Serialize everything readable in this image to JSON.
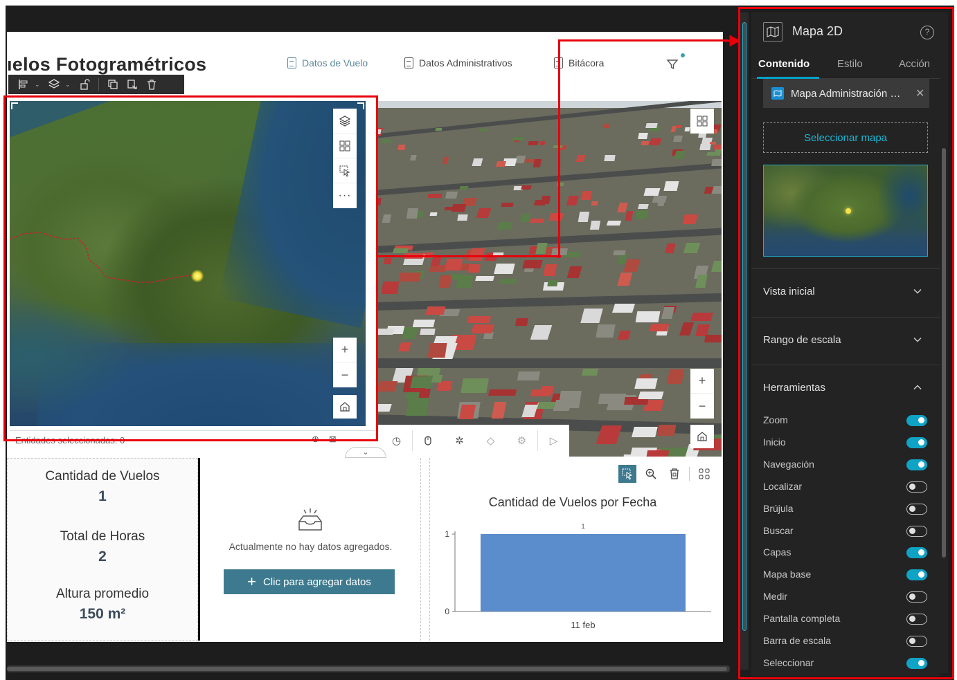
{
  "page": {
    "title": "ıelos Fotogramétricos"
  },
  "nav": {
    "items": [
      {
        "label": "Datos de Vuelo",
        "active": true
      },
      {
        "label": "Datos Administrativos",
        "active": false
      },
      {
        "label": "Bitácora",
        "active": false
      }
    ]
  },
  "widget_toolbar": {
    "icons": [
      "align-icon",
      "layers-icon",
      "unlock-icon",
      "duplicate-icon",
      "copy-to-icon",
      "delete-icon"
    ]
  },
  "map2d": {
    "tools": [
      "layers-icon",
      "basemap-gallery-icon",
      "select-icon",
      "more-icon"
    ],
    "zoom_in": "+",
    "zoom_out": "−",
    "selection_text": "Entidades seleccionadas: 0"
  },
  "scene3d": {
    "zoom_in": "+",
    "zoom_out": "−",
    "bottom_tools": [
      "timer-icon",
      "pan-icon",
      "select-pointer-icon",
      "eraser-icon",
      "settings-icon",
      "play-icon"
    ]
  },
  "stats": {
    "items": [
      {
        "label": "Cantidad de Vuelos",
        "value": "1"
      },
      {
        "label": "Total de Horas",
        "value": "2"
      },
      {
        "label": "Altura promedio",
        "value": "150 m²"
      }
    ]
  },
  "empty_widget": {
    "message": "Actualmente no hay datos agregados.",
    "button_label": "Clic para agregar datos"
  },
  "chart_data": {
    "type": "bar",
    "title": "Cantidad de Vuelos por Fecha",
    "categories": [
      "11 feb"
    ],
    "values": [
      1
    ],
    "data_labels": [
      "1"
    ],
    "ylim": [
      0,
      1
    ],
    "yticks": [
      "0",
      "1"
    ],
    "xlabel": "",
    "ylabel": "",
    "bar_color": "#5b8ccb"
  },
  "panel": {
    "title": "Mapa 2D",
    "help": "?",
    "tabs": [
      {
        "label": "Contenido",
        "active": true
      },
      {
        "label": "Estilo",
        "active": false
      },
      {
        "label": "Acción",
        "active": false
      }
    ],
    "map_chip": "Mapa Administración de Vuelos",
    "select_map_label": "Seleccionar mapa",
    "sections": [
      {
        "title": "Vista inicial",
        "expanded": false
      },
      {
        "title": "Rango de escala",
        "expanded": false
      },
      {
        "title": "Herramientas",
        "expanded": true
      }
    ],
    "tools": [
      {
        "name": "Zoom",
        "on": true
      },
      {
        "name": "Inicio",
        "on": true
      },
      {
        "name": "Navegación",
        "on": true
      },
      {
        "name": "Localizar",
        "on": false
      },
      {
        "name": "Brújula",
        "on": false
      },
      {
        "name": "Buscar",
        "on": false
      },
      {
        "name": "Capas",
        "on": true
      },
      {
        "name": "Mapa base",
        "on": true
      },
      {
        "name": "Medir",
        "on": false
      },
      {
        "name": "Pantalla completa",
        "on": false
      },
      {
        "name": "Barra de escala",
        "on": false
      },
      {
        "name": "Seleccionar",
        "on": true
      }
    ]
  },
  "colors": {
    "accent": "#0fa3c5",
    "primary_button": "#3d7a8f",
    "annotation_red": "#e8000b",
    "panel_bg": "#232323"
  }
}
